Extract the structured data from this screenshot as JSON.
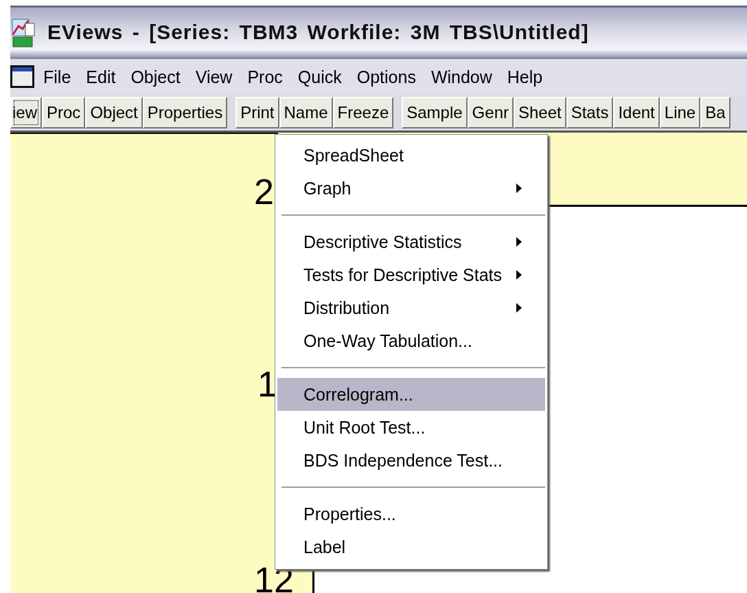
{
  "window": {
    "title": "EViews - [Series: TBM3   Workfile: 3M TBS\\Untitled]"
  },
  "menu_bar": [
    "File",
    "Edit",
    "Object",
    "View",
    "Proc",
    "Quick",
    "Options",
    "Window",
    "Help"
  ],
  "toolbar": [
    [
      {
        "label": "iew",
        "focused": true
      },
      {
        "label": "Proc",
        "focused": false
      },
      {
        "label": "Object",
        "focused": false
      },
      {
        "label": "Properties",
        "focused": false
      }
    ],
    [
      {
        "label": "Print",
        "focused": false
      },
      {
        "label": "Name",
        "focused": false
      },
      {
        "label": "Freeze",
        "focused": false
      }
    ],
    [
      {
        "label": "Sample",
        "focused": false
      },
      {
        "label": "Genr",
        "focused": false
      },
      {
        "label": "Sheet",
        "focused": false
      },
      {
        "label": "Stats",
        "focused": false
      },
      {
        "label": "Ident",
        "focused": false
      },
      {
        "label": "Line",
        "focused": false
      },
      {
        "label": "Ba",
        "focused": false
      }
    ]
  ],
  "graph": {
    "axis_labels": [
      "2",
      "1",
      "12"
    ]
  },
  "context_menu": [
    {
      "kind": "item",
      "label": "SpreadSheet",
      "submenu": false,
      "selected": false
    },
    {
      "kind": "item",
      "label": "Graph",
      "submenu": true,
      "selected": false
    },
    {
      "kind": "separator"
    },
    {
      "kind": "item",
      "label": "Descriptive Statistics",
      "submenu": true,
      "selected": false
    },
    {
      "kind": "item",
      "label": "Tests for Descriptive Stats",
      "submenu": true,
      "selected": false
    },
    {
      "kind": "item",
      "label": "Distribution",
      "submenu": true,
      "selected": false
    },
    {
      "kind": "item",
      "label": "One-Way Tabulation...",
      "submenu": false,
      "selected": false
    },
    {
      "kind": "separator"
    },
    {
      "kind": "item",
      "label": "Correlogram...",
      "submenu": false,
      "selected": true
    },
    {
      "kind": "item",
      "label": "Unit Root Test...",
      "submenu": false,
      "selected": false
    },
    {
      "kind": "item",
      "label": "BDS Independence Test...",
      "submenu": false,
      "selected": false
    },
    {
      "kind": "separator"
    },
    {
      "kind": "item",
      "label": "Properties...",
      "submenu": false,
      "selected": false
    },
    {
      "kind": "item",
      "label": "Label",
      "submenu": false,
      "selected": false
    }
  ]
}
